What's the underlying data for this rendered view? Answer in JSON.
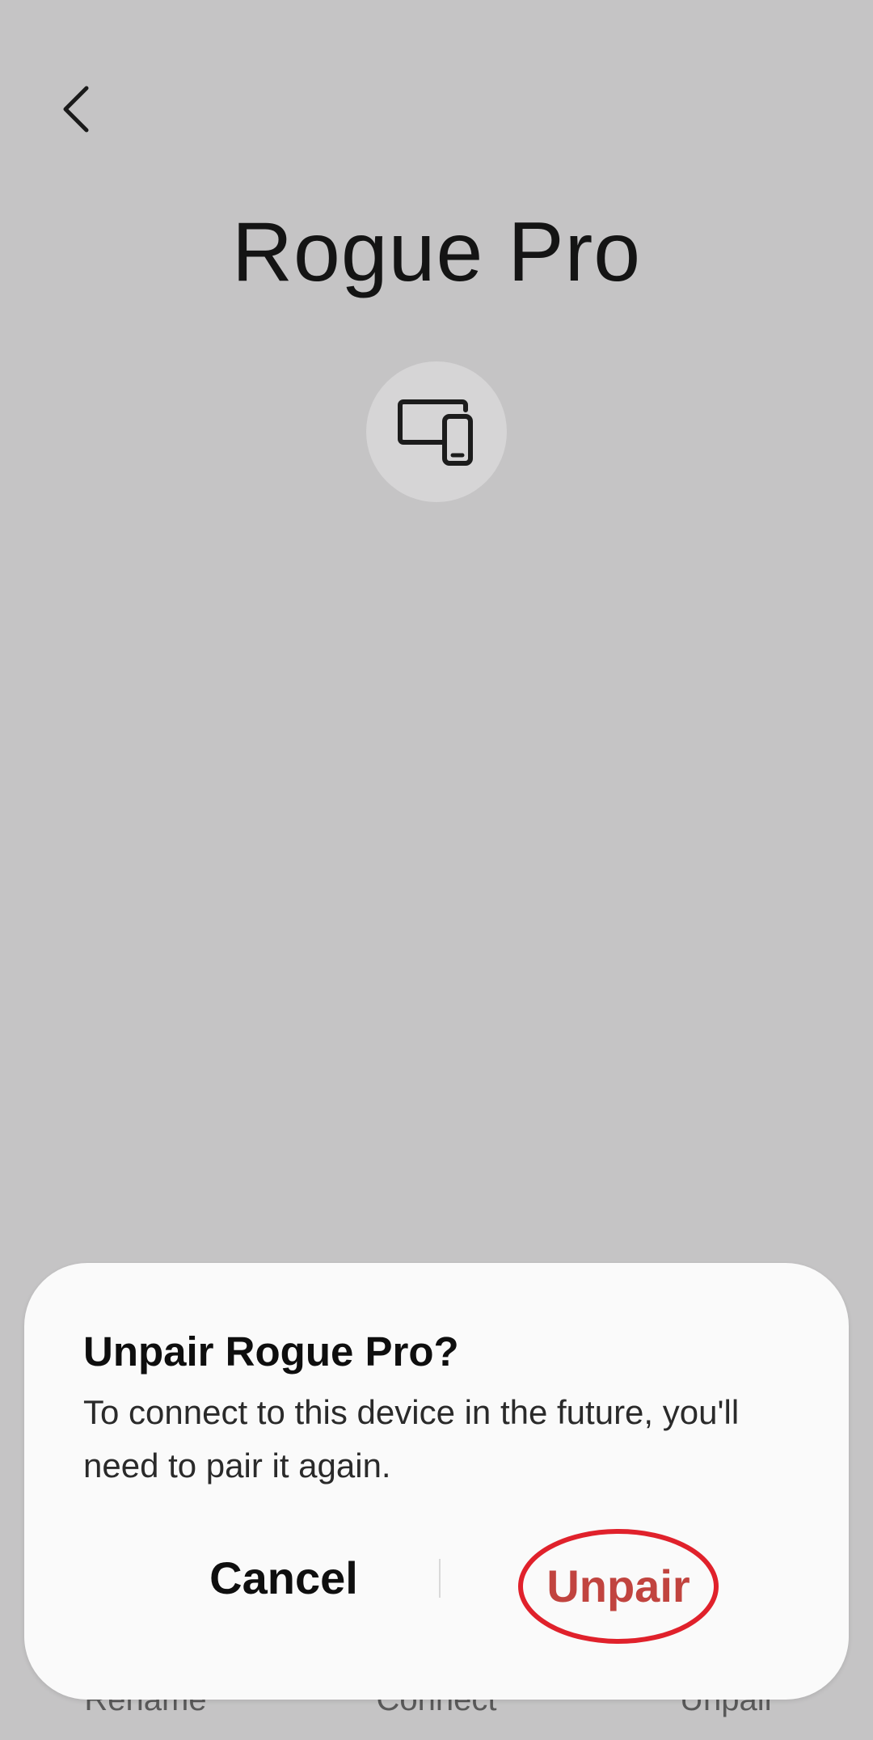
{
  "page": {
    "title": "Rogue Pro",
    "back_icon": "chevron-left-icon",
    "device_icon": "devices-icon"
  },
  "bottom_bar": {
    "items": [
      {
        "label": "Rename"
      },
      {
        "label": "Connect"
      },
      {
        "label": "Unpair"
      }
    ]
  },
  "dialog": {
    "title": "Unpair Rogue Pro?",
    "message": "To connect to this device in the future, you'll need to pair it again.",
    "cancel_label": "Cancel",
    "confirm_label": "Unpair"
  },
  "colors": {
    "background": "#c5c4c5",
    "dialog_background": "#fafafa",
    "destructive_action": "#c1443f",
    "highlight_ring": "#e0212b"
  }
}
